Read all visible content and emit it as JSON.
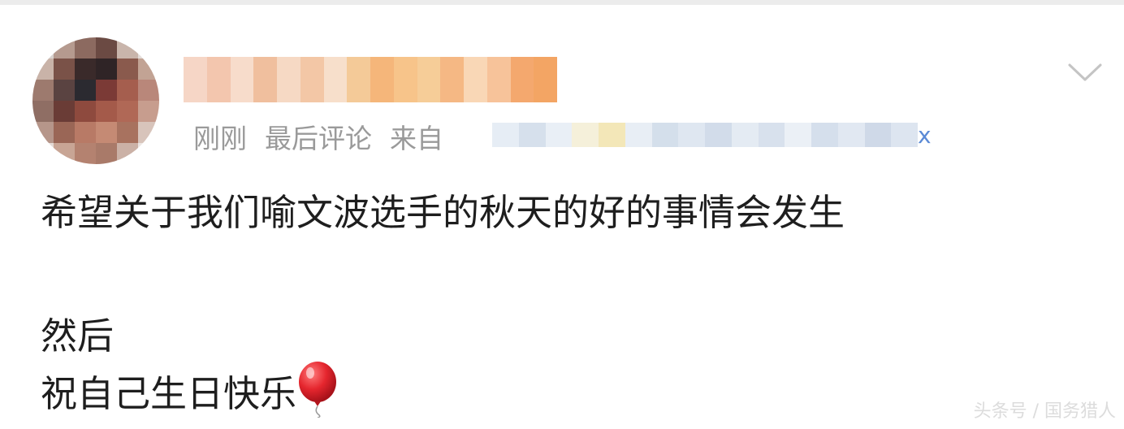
{
  "post": {
    "meta": {
      "time": "刚刚",
      "label": "最后评论",
      "source_prefix": "来自",
      "source_tail": "x"
    },
    "content": {
      "line1": "希望关于我们喻文波选手的秋天的好的事情会发生",
      "line2": "然后",
      "line3": "祝自己生日快乐"
    },
    "icons": {
      "dropdown": "chevron-down-icon",
      "emoji": "balloon-icon"
    }
  },
  "watermark": "头条号 / 国务猎人",
  "colors": {
    "meta_text": "#9a9a9a",
    "content_text": "#1e1e1e",
    "link_blue": "#5b8ad6",
    "balloon_red": "#e5262e"
  }
}
